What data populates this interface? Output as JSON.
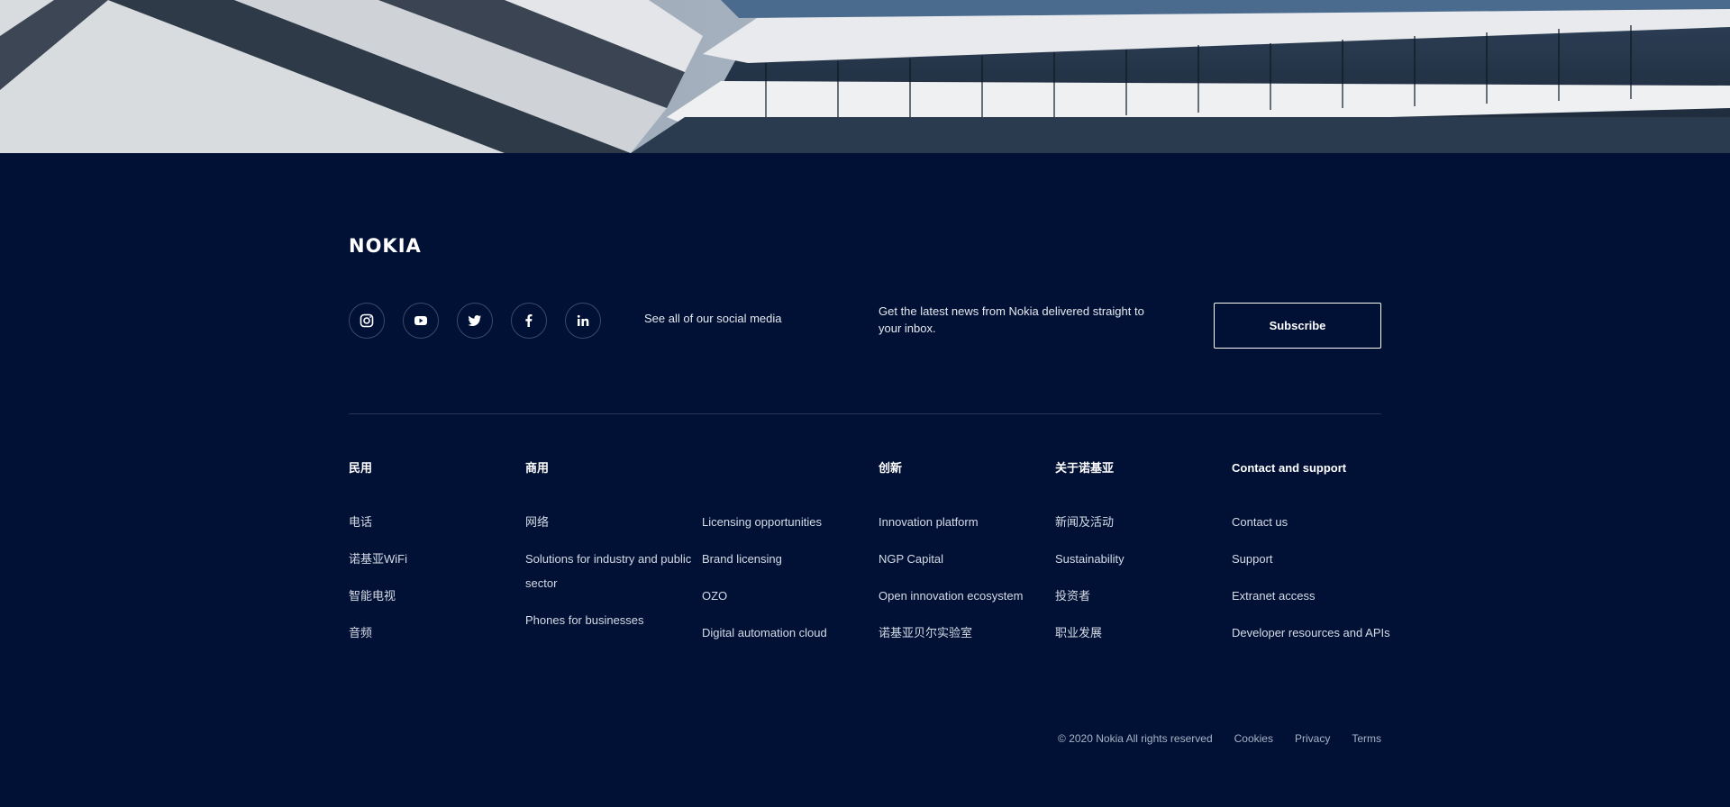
{
  "brand": {
    "logo_text": "NOKIA"
  },
  "social": {
    "icons": [
      "instagram-icon",
      "youtube-icon",
      "twitter-icon",
      "facebook-icon",
      "linkedin-icon"
    ],
    "label": "See all of our social media"
  },
  "newsletter": {
    "text": "Get the latest news from Nokia delivered straight to your inbox.",
    "button_label": "Subscribe"
  },
  "columns": {
    "consumer": {
      "heading": "民用",
      "links": [
        "电话",
        "诺基亚WiFi",
        "智能电视",
        "音频"
      ]
    },
    "business": {
      "heading": "商用",
      "links": [
        "网络",
        "Solutions for industry and public sector",
        "Phones for businesses"
      ]
    },
    "business2": {
      "heading": "",
      "links": [
        "Licensing opportunities",
        "Brand licensing",
        "OZO",
        "Digital automation cloud"
      ]
    },
    "innovation": {
      "heading": "创新",
      "links": [
        "Innovation platform",
        "NGP Capital",
        "Open innovation ecosystem",
        "诺基亚贝尔实验室"
      ]
    },
    "about": {
      "heading": "关于诺基亚",
      "links": [
        "新闻及活动",
        "Sustainability",
        "投资者",
        "职业发展"
      ]
    },
    "support": {
      "heading": "Contact and support",
      "links": [
        "Contact us",
        "Support",
        "Extranet access",
        "Developer resources and APIs"
      ]
    }
  },
  "legal": {
    "copyright": "© 2020 Nokia All rights reserved",
    "cookies": "Cookies",
    "privacy": "Privacy",
    "terms": "Terms"
  },
  "colors": {
    "background": "#001135",
    "divider": "#24355a"
  }
}
